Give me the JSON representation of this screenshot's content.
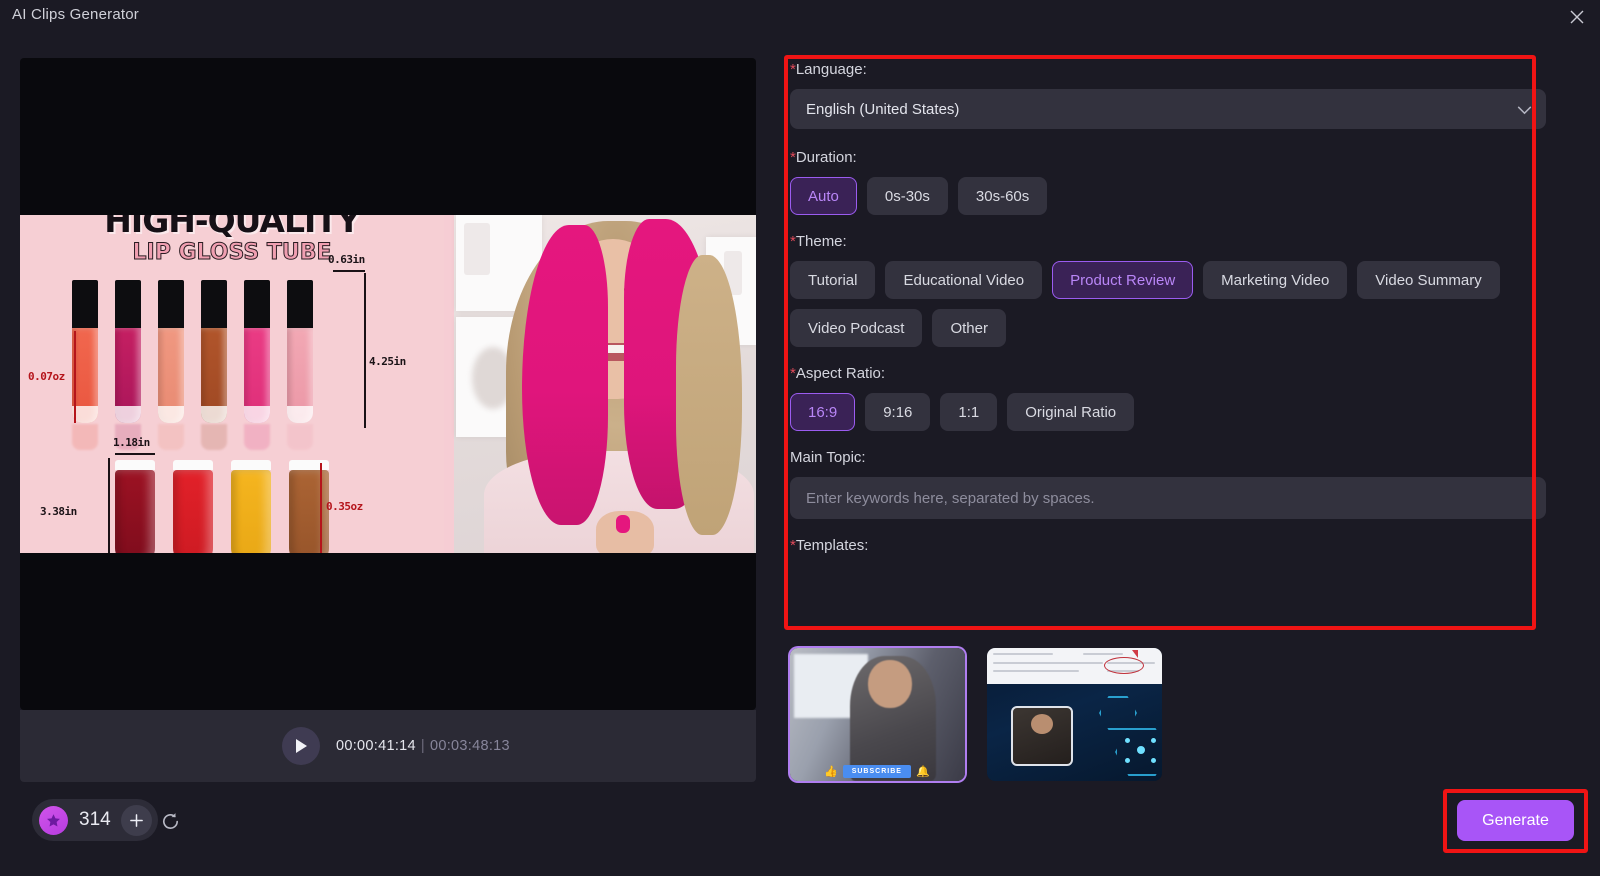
{
  "window": {
    "title": "AI Clips Generator",
    "close_icon": "close-icon"
  },
  "preview": {
    "player": {
      "play_icon": "play-icon",
      "current_time": "00:00:41:14",
      "separator": "|",
      "total_time": "00:03:48:13"
    },
    "video_overlay": {
      "headline": "HIGH-QUALITY",
      "subhead": "LIP GLOSS TUBE",
      "dimensions": {
        "capacity_small": "0.07oz",
        "width_top": "0.63in",
        "height_top": "4.25in",
        "width_bottom": "1.18in",
        "height_bottom": "3.38in",
        "capacity_large": "0.35oz"
      }
    }
  },
  "bottom_bar": {
    "star_icon": "star-icon",
    "credits": "314",
    "add_icon": "plus-icon",
    "reset_icon": "refresh-icon",
    "generate_label": "Generate"
  },
  "form": {
    "language": {
      "label": "Language:",
      "required_mark": "*",
      "value": "English (United States)",
      "chevron_icon": "chevron-down-icon"
    },
    "duration": {
      "label": "Duration:",
      "required_mark": "*",
      "options": [
        "Auto",
        "0s-30s",
        "30s-60s"
      ],
      "selected": "Auto"
    },
    "theme": {
      "label": "Theme:",
      "required_mark": "*",
      "options": [
        "Tutorial",
        "Educational Video",
        "Product Review",
        "Marketing Video",
        "Video Summary",
        "Video Podcast",
        "Other"
      ],
      "selected": "Product Review"
    },
    "aspect_ratio": {
      "label": "Aspect Ratio:",
      "required_mark": "*",
      "options": [
        "16:9",
        "9:16",
        "1:1",
        "Original Ratio"
      ],
      "selected": "16:9"
    },
    "main_topic": {
      "label": "Main Topic:",
      "value": "",
      "placeholder": "Enter keywords here, separated by spaces."
    },
    "templates": {
      "label": "Templates:",
      "required_mark": "*",
      "items": [
        {
          "name": "template-speaker-subscribe",
          "subscribe_label": "SUBSCRIBE",
          "selected": true
        },
        {
          "name": "template-tech-hexagon",
          "selected": false
        }
      ]
    }
  },
  "colors": {
    "accent_purple": "#a855f7",
    "chip_selected_border": "#9b5cf0",
    "required_red": "#e04a5a",
    "highlight_red": "#f01414",
    "panel_bg": "#1b1a24",
    "control_bg": "#33323e"
  }
}
